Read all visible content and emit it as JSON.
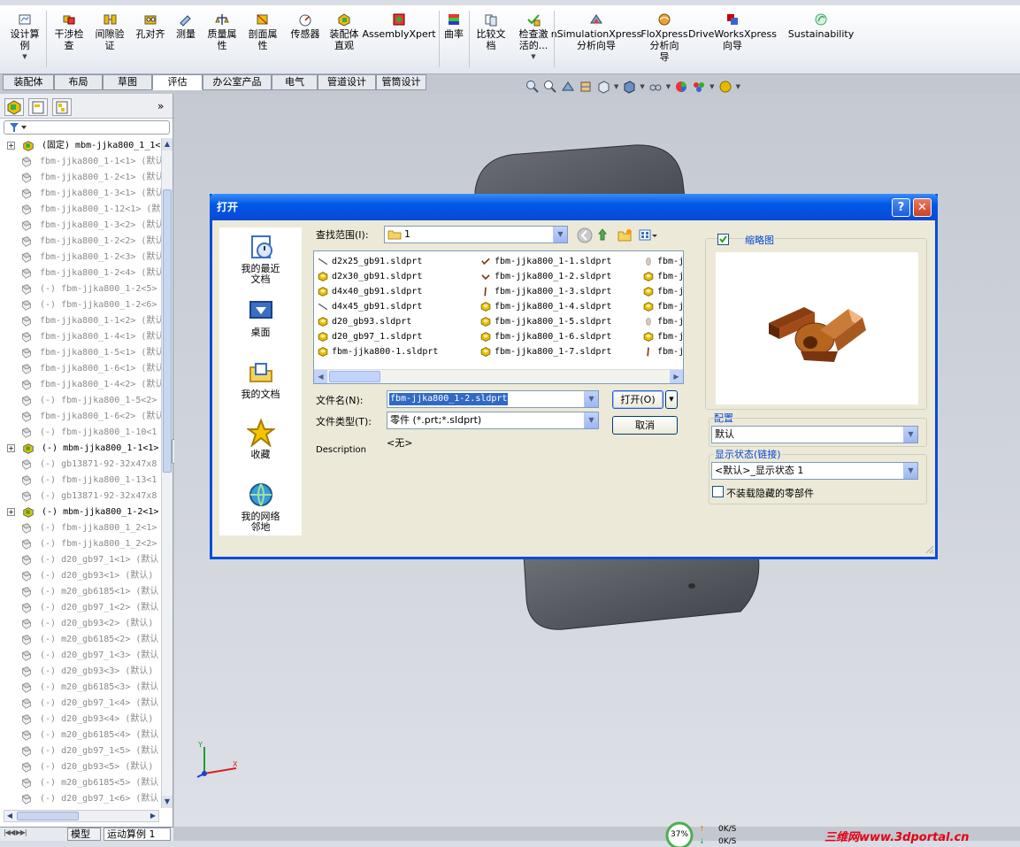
{
  "ribbon": {
    "buttons": [
      {
        "label": "设计算\n例",
        "icon": "design-study-icon"
      },
      {
        "label": "干涉检\n查",
        "icon": "interference-icon"
      },
      {
        "label": "间隙验\n证",
        "icon": "clearance-icon"
      },
      {
        "label": "孔对齐",
        "icon": "hole-align-icon"
      },
      {
        "label": "测量",
        "icon": "measure-icon"
      },
      {
        "label": "质量属\n性",
        "icon": "mass-props-icon"
      },
      {
        "label": "剖面属\n性",
        "icon": "section-props-icon"
      },
      {
        "label": "传感器",
        "icon": "sensor-icon"
      },
      {
        "label": "装配体\n直观",
        "icon": "assembly-visual-icon"
      },
      {
        "label": "AssemblyXpert",
        "icon": "assemblyxpert-icon"
      },
      {
        "label": "曲率",
        "icon": "curvature-icon"
      },
      {
        "label": "比较文\n档",
        "icon": "compare-icon"
      },
      {
        "label": "检查激\n活的...",
        "icon": "check-icon"
      },
      {
        "label": "nSimulationXpress\n分析向导",
        "icon": "simulation-icon"
      },
      {
        "label": "FloXpress\n分析向\n导",
        "icon": "floxpress-icon"
      },
      {
        "label": "DriveWorksXpress\n向导",
        "icon": "driveworks-icon"
      },
      {
        "label": "Sustainability",
        "icon": "sustainability-icon"
      }
    ]
  },
  "command_tabs": [
    "装配体",
    "布局",
    "草图",
    "评估",
    "办公室产品",
    "电气",
    "管道设计",
    "管筒设计"
  ],
  "active_tab": "评估",
  "tree": {
    "rows": [
      {
        "level": 0,
        "expand": true,
        "kind": "asm",
        "text": "(固定) mbm-jjka800_1_1<",
        "grey": false
      },
      {
        "level": 1,
        "kind": "part",
        "text": "fbm-jjka800_1-1<1> (默认",
        "grey": true
      },
      {
        "level": 1,
        "kind": "part",
        "text": "fbm-jjka800_1-2<1> (默认",
        "grey": true
      },
      {
        "level": 1,
        "kind": "part",
        "text": "fbm-jjka800_1-3<1> (默认",
        "grey": true
      },
      {
        "level": 1,
        "kind": "part",
        "text": "fbm-jjka800_1-12<1> (默",
        "grey": true
      },
      {
        "level": 1,
        "kind": "part",
        "text": "fbm-jjka800_1-3<2> (默认",
        "grey": true
      },
      {
        "level": 1,
        "kind": "part",
        "text": "fbm-jjka800_1-2<2> (默认",
        "grey": true
      },
      {
        "level": 1,
        "kind": "part",
        "text": "fbm-jjka800_1-2<3> (默认",
        "grey": true
      },
      {
        "level": 1,
        "kind": "part",
        "text": "fbm-jjka800_1-2<4> (默认",
        "grey": true
      },
      {
        "level": 1,
        "kind": "part",
        "text": "(-) fbm-jjka800_1-2<5>",
        "grey": true
      },
      {
        "level": 1,
        "kind": "part",
        "text": "(-) fbm-jjka800_1-2<6>",
        "grey": true
      },
      {
        "level": 1,
        "kind": "part",
        "text": "fbm-jjka800_1-1<2> (默认",
        "grey": true
      },
      {
        "level": 1,
        "kind": "part",
        "text": "fbm-jjka800_1-4<1> (默认",
        "grey": true
      },
      {
        "level": 1,
        "kind": "part",
        "text": "fbm-jjka800_1-5<1> (默认",
        "grey": true
      },
      {
        "level": 1,
        "kind": "part",
        "text": "fbm-jjka800_1-6<1> (默认",
        "grey": true
      },
      {
        "level": 1,
        "kind": "part",
        "text": "fbm-jjka800_1-4<2> (默认",
        "grey": true
      },
      {
        "level": 1,
        "kind": "part",
        "text": "(-) fbm-jjka800_1-5<2>",
        "grey": true
      },
      {
        "level": 1,
        "kind": "part",
        "text": "fbm-jjka800_1-6<2> (默认",
        "grey": true
      },
      {
        "level": 1,
        "kind": "part",
        "text": "(-) fbm-jjka800_1-10<1",
        "grey": true
      },
      {
        "level": 0,
        "expand": true,
        "kind": "asm",
        "text": "(-) mbm-jjka800_1-1<1>",
        "grey": false
      },
      {
        "level": 1,
        "kind": "part",
        "text": "(-) gb13871-92-32x47x8",
        "grey": true
      },
      {
        "level": 1,
        "kind": "part",
        "text": "(-) fbm-jjka800_1-13<1",
        "grey": true
      },
      {
        "level": 1,
        "kind": "part",
        "text": "(-) gb13871-92-32x47x8",
        "grey": true
      },
      {
        "level": 0,
        "expand": true,
        "kind": "asm",
        "text": "(-) mbm-jjka800_1-2<1>",
        "grey": false
      },
      {
        "level": 1,
        "kind": "part",
        "text": "(-) fbm-jjka800_1_2<1>",
        "grey": true
      },
      {
        "level": 1,
        "kind": "part",
        "text": "(-) fbm-jjka800_1_2<2>",
        "grey": true
      },
      {
        "level": 1,
        "kind": "part",
        "text": "(-) d20_gb97_1<1> (默认",
        "grey": true
      },
      {
        "level": 1,
        "kind": "part",
        "text": "(-) d20_gb93<1> (默认)",
        "grey": true
      },
      {
        "level": 1,
        "kind": "part",
        "text": "(-) m20_gb6185<1> (默认",
        "grey": true
      },
      {
        "level": 1,
        "kind": "part",
        "text": "(-) d20_gb97_1<2> (默认",
        "grey": true
      },
      {
        "level": 1,
        "kind": "part",
        "text": "(-) d20_gb93<2> (默认)",
        "grey": true
      },
      {
        "level": 1,
        "kind": "part",
        "text": "(-) m20_gb6185<2> (默认",
        "grey": true
      },
      {
        "level": 1,
        "kind": "part",
        "text": "(-) d20_gb97_1<3> (默认",
        "grey": true
      },
      {
        "level": 1,
        "kind": "part",
        "text": "(-) d20_gb93<3> (默认)",
        "grey": true
      },
      {
        "level": 1,
        "kind": "part",
        "text": "(-) m20_gb6185<3> (默认",
        "grey": true
      },
      {
        "level": 1,
        "kind": "part",
        "text": "(-) d20_gb97_1<4> (默认",
        "grey": true
      },
      {
        "level": 1,
        "kind": "part",
        "text": "(-) d20_gb93<4> (默认)",
        "grey": true
      },
      {
        "level": 1,
        "kind": "part",
        "text": "(-) m20_gb6185<4> (默认",
        "grey": true
      },
      {
        "level": 1,
        "kind": "part",
        "text": "(-) d20_gb97_1<5> (默认",
        "grey": true
      },
      {
        "level": 1,
        "kind": "part",
        "text": "(-) d20_gb93<5> (默认)",
        "grey": true
      },
      {
        "level": 1,
        "kind": "part",
        "text": "(-) m20_gb6185<5> (默认",
        "grey": true
      },
      {
        "level": 1,
        "kind": "part",
        "text": "(-) d20_gb97_1<6> (默认",
        "grey": true
      }
    ]
  },
  "bottom_tabs": [
    "模型",
    "运动算例 1"
  ],
  "dialog": {
    "title": "打开",
    "lookin_label": "查找范围(I):",
    "lookin_value": "1",
    "places": [
      {
        "label": "我的最近\n文档",
        "icon": "recent-docs-icon"
      },
      {
        "label": "桌面",
        "icon": "desktop-icon"
      },
      {
        "label": "我的文档",
        "icon": "my-documents-icon"
      },
      {
        "label": "收藏",
        "icon": "favorites-star-icon"
      },
      {
        "label": "我的网络\n邻地",
        "icon": "network-icon"
      }
    ],
    "files_col1": [
      {
        "name": "d2x25_gb91.sldprt",
        "icon": "pin"
      },
      {
        "name": "d2x30_gb91.sldprt",
        "icon": "part"
      },
      {
        "name": "d4x40_gb91.sldprt",
        "icon": "part"
      },
      {
        "name": "d4x45_gb91.sldprt",
        "icon": "pin"
      },
      {
        "name": "d20_gb93.sldprt",
        "icon": "part"
      },
      {
        "name": "d20_gb97_1.sldprt",
        "icon": "part"
      },
      {
        "name": "fbm-jjka800-1.sldprt",
        "icon": "part"
      }
    ],
    "files_col2": [
      {
        "name": "fbm-jjka800_1-1.sldprt",
        "icon": "check"
      },
      {
        "name": "fbm-jjka800_1-2.sldprt",
        "icon": "arrow"
      },
      {
        "name": "fbm-jjka800_1-3.sldprt",
        "icon": "rod"
      },
      {
        "name": "fbm-jjka800_1-4.sldprt",
        "icon": "part"
      },
      {
        "name": "fbm-jjka800_1-5.sldprt",
        "icon": "part"
      },
      {
        "name": "fbm-jjka800_1-6.sldprt",
        "icon": "part"
      },
      {
        "name": "fbm-jjka800_1-7.sldprt",
        "icon": "part"
      }
    ],
    "files_col3": [
      {
        "name": "fbm-j",
        "icon": "oval"
      },
      {
        "name": "fbm-j",
        "icon": "part"
      },
      {
        "name": "fbm-j",
        "icon": "part"
      },
      {
        "name": "fbm-j",
        "icon": "part"
      },
      {
        "name": "fbm-j",
        "icon": "oval"
      },
      {
        "name": "fbm-j",
        "icon": "part"
      },
      {
        "name": "fbm-j",
        "icon": "rod"
      }
    ],
    "filename_label": "文件名(N):",
    "filename_value": "fbm-jjka800_1-2.sldprt",
    "filetype_label": "文件类型(T):",
    "filetype_value": "零件 (*.prt;*.sldprt)",
    "description_label": "Description",
    "description_value": "<无>",
    "open_label": "打开(O)",
    "cancel_label": "取消",
    "thumbnail_label": "缩略图",
    "config_label": "配置",
    "config_value": "默认",
    "display_state_label": "显示状态(链接)",
    "display_state_value": "<默认>_显示状态 1",
    "hidden_parts_label": "不装载隐藏的零部件"
  },
  "status": {
    "percent": "37%",
    "up": "0K/S",
    "down": "0K/S"
  },
  "watermark": "三维网www.3dportal.cn",
  "colors": {
    "titlebar": "#0058e6",
    "accent": "#0046d5",
    "part_copper": "#b5651d"
  }
}
